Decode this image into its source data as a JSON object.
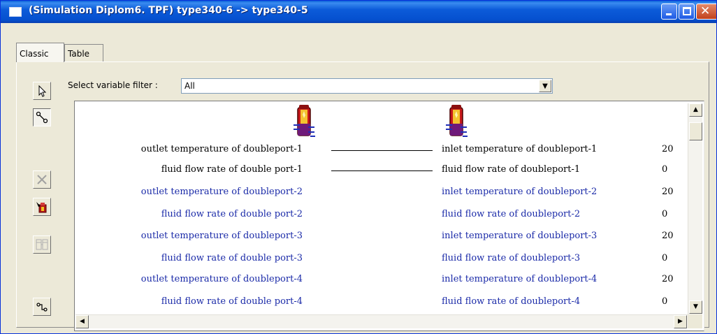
{
  "window": {
    "title": "(Simulation Diplom6. TPF) type340-6 -> type340-5",
    "close_glyph": "✕"
  },
  "tabs": [
    {
      "label": "Classic",
      "active": true
    },
    {
      "label": "Table",
      "active": false
    }
  ],
  "toolbar": {
    "icons": [
      "pointer-icon",
      "link-icon",
      "delete-icon",
      "auto-connect-icon",
      "table-icon",
      "connect-icon"
    ]
  },
  "filter": {
    "label": "Select variable filter :",
    "value": "All"
  },
  "components": {
    "source_icon": "storage-tank-icon",
    "target_icon": "storage-tank-icon"
  },
  "connections": [
    {
      "source": "outlet temperature of doubleport-1",
      "target": "inlet temperature of doubleport-1",
      "value": "20",
      "connected": true
    },
    {
      "source": "fluid flow rate of double port-1",
      "target": "fluid flow rate of doubleport-1",
      "value": "0",
      "connected": true
    },
    {
      "source": "outlet temperature of doubleport-2",
      "target": "inlet temperature of doubleport-2",
      "value": "20",
      "connected": false
    },
    {
      "source": "fluid flow rate of double port-2",
      "target": "fluid flow rate of doubleport-2",
      "value": "0",
      "connected": false
    },
    {
      "source": "outlet temperature of doubleport-3",
      "target": "inlet temperature of doubleport-3",
      "value": "20",
      "connected": false
    },
    {
      "source": "fluid flow rate of double port-3",
      "target": "fluid flow rate of doubleport-3",
      "value": "0",
      "connected": false
    },
    {
      "source": "outlet temperature of doubleport-4",
      "target": "inlet temperature of doubleport-4",
      "value": "20",
      "connected": false
    },
    {
      "source": "fluid flow rate of double port-4",
      "target": "fluid flow rate of doubleport-4",
      "value": "0",
      "connected": false
    }
  ],
  "colors": {
    "connected_text": "#000000",
    "unconnected_text": "#1a2aa8",
    "titlebar": "#0550cf"
  }
}
